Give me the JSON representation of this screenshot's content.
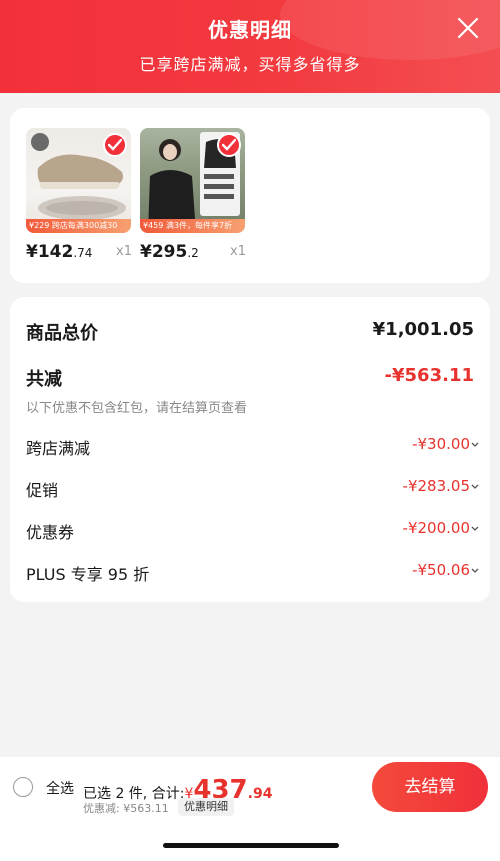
{
  "header": {
    "title": "优惠明细",
    "subtitle": "已享跨店满减，买得多省得多"
  },
  "products": [
    {
      "price_int": "¥142",
      "price_dec": ".74",
      "qty": "x1",
      "banner": "¥229 跨店每满300减30"
    },
    {
      "price_int": "¥295",
      "price_dec": ".2",
      "qty": "x1",
      "banner": "¥459 满3件，每件享7折"
    }
  ],
  "summary": {
    "total_label": "商品总价",
    "total_amount": "¥1,001.05",
    "reduce_label": "共减",
    "reduce_amount": "-¥563.11",
    "note": "以下优惠不包含红包，请在结算页查看",
    "items": [
      {
        "label": "跨店满减",
        "amount": "-¥30.00"
      },
      {
        "label": "促销",
        "amount": "-¥283.05"
      },
      {
        "label": "优惠券",
        "amount": "-¥200.00"
      },
      {
        "label": "PLUS 专享 95 折",
        "amount": "-¥50.06"
      }
    ]
  },
  "bottom": {
    "select_all": "全选",
    "selected_text": "已选 2 件, 合计:",
    "total_currency": "¥",
    "total_int": "437",
    "total_dec": ".94",
    "saved": "优惠减: ¥563.11",
    "detail_tag": "优惠明细",
    "checkout": "去结算"
  },
  "colors": {
    "accent": "#f2303a",
    "price_red": "#e8322d"
  }
}
